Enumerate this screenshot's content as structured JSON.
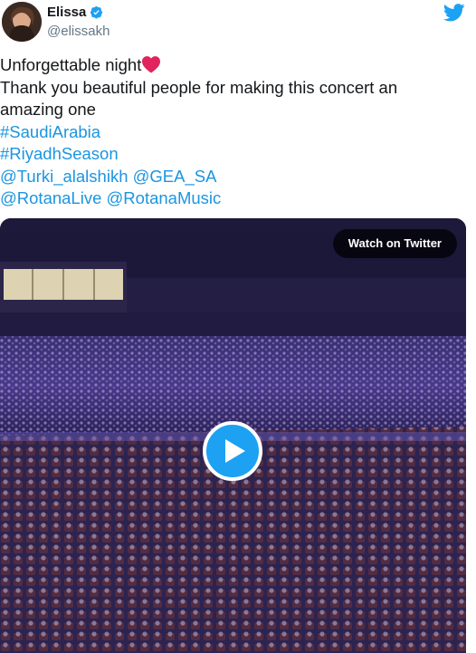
{
  "user": {
    "display_name": "Elissa",
    "handle": "@elissakh",
    "verified": true,
    "avatar_icon": "profile-photo"
  },
  "brand": {
    "icon": "twitter-bird-icon",
    "color": "#1da1f2"
  },
  "tweet": {
    "line1": "Unforgettable night",
    "line2": "Thank you beautiful people for making this concert an",
    "line3": "amazing one",
    "hashtag1": "#SaudiArabia",
    "hashtag2": "#RiyadhSeason",
    "mention1": "@Turki_alalshikh",
    "mention2": "@GEA_SA",
    "mention3": "@RotanaLive",
    "mention4": "@RotanaMusic"
  },
  "media": {
    "watch_label": "Watch on Twitter",
    "play_icon": "play-icon"
  },
  "colors": {
    "link": "#1b95e0",
    "heart": "#e0245e",
    "text": "#14171a",
    "muted": "#657786"
  }
}
